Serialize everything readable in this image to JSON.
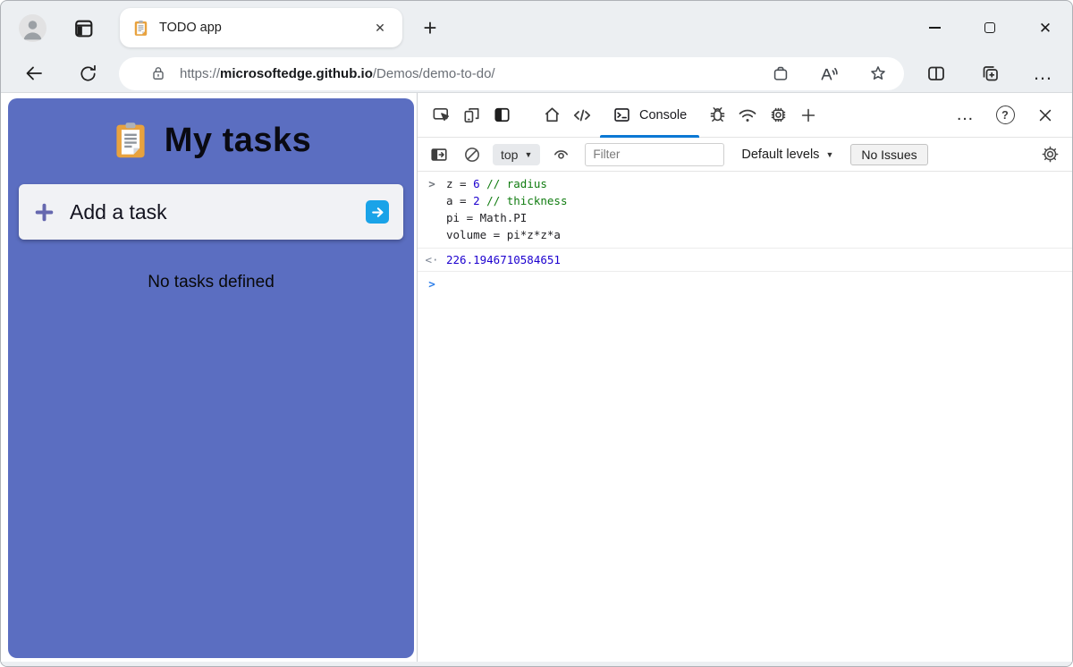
{
  "glyphs": {
    "close_tab": "✕",
    "new_tab": "+",
    "close_window": "✕",
    "more": "…",
    "help": "?",
    "caret": "▼",
    "result_arrow": "<·",
    "command_chevron": ">",
    "prompt_chevron": ">"
  },
  "tab_strip": {
    "tab_title": "TODO app"
  },
  "nav": {
    "url_scheme": "https://",
    "url_domain": "microsoftedge.github.io",
    "url_path": "/Demos/demo-to-do/"
  },
  "page": {
    "title": "My tasks",
    "add_task_label": "Add a task",
    "empty_state": "No tasks defined",
    "colors": {
      "panel_purple": "#5b6ec1",
      "submit_blue": "#1aa3e8",
      "plus_purple": "#6668af",
      "clipboard_orange": "#e8a23e"
    }
  },
  "devtools": {
    "console_tab_label": "Console",
    "toolbar": {
      "context": "top",
      "filter_placeholder": "Filter",
      "levels_label": "Default levels",
      "issues_label": "No Issues"
    },
    "console": {
      "input_lines": [
        {
          "t0": "z = ",
          "num": "6",
          "t1": " ",
          "comment": "// radius"
        },
        {
          "t0": "a = ",
          "num": "2",
          "t1": " ",
          "comment": "// thickness"
        },
        {
          "t0": "pi = Math.PI"
        },
        {
          "t0": "volume = pi*z*z*a"
        }
      ],
      "result": "226.1946710584651"
    },
    "colors": {
      "active_tab_underline": "#0b78d4",
      "number_literal": "#1c00cf",
      "comment_green": "#107c10"
    }
  }
}
